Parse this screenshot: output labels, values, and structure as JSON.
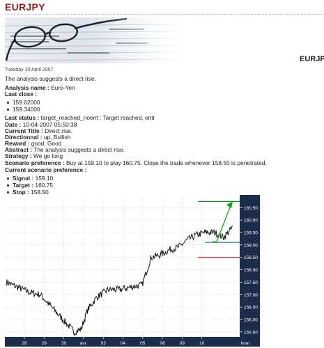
{
  "page": {
    "title": "EURJPY",
    "side_symbol": "EURJPY",
    "date_line": "Tuesday 10 April 2007",
    "summary": "The analysis suggests a direct rise."
  },
  "analysis": {
    "name_label": "Analysis name :",
    "name_value": " Euro-Yen",
    "last_close_label": "Last close :",
    "last_close": [
      "159.62000",
      "159.34000"
    ],
    "status_label": "Last status :",
    "status_value": " target_reached_noent ; Target reached, entr",
    "date_label": "Date :",
    "date_value": " 10-04-2007 05:50:38",
    "title_label": "Current Title :",
    "title_value": " Direct rise.",
    "direction_label": "Directionnal :",
    "direction_value": " up, Bullish",
    "reward_label": "Reward :",
    "reward_value": " good, Good",
    "abstract_label": "Abstract :",
    "abstract_value": " The analysis suggests a direct rise.",
    "strategy_label": "Strategy :",
    "strategy_value": " We go long",
    "scenario_label": "Scenario preference :",
    "scenario_value": " Buy at 159.10 to play 160.75. Close the trade whenever 158.50 is penetrated.",
    "current_pref_label": "Current scenario preference :",
    "signal_label": "Signal :",
    "signal_value": "159.10",
    "target_label": "Target :",
    "target_value": "160.75",
    "stop_label": "Stop :",
    "stop_value": "158.50"
  },
  "chart_data": {
    "type": "line",
    "instrument": "EURJPY",
    "y_ticks": [
      "155.50",
      "156.00",
      "156.50",
      "157.00",
      "157.50",
      "158.00",
      "158.50",
      "159.00",
      "159.50",
      "160.00",
      "160.50"
    ],
    "x_ticks": [
      "28",
      "29",
      "30",
      "avr.",
      "03",
      "04",
      "05",
      "06",
      "09",
      "10",
      "hour"
    ],
    "ylim": [
      155.3,
      160.9
    ],
    "levels": [
      {
        "name": "Target",
        "value": 160.75,
        "label": "160",
        "color": "#0b9a16"
      },
      {
        "name": "Signal",
        "value": 159.1,
        "label": "159.10",
        "color": "#2f8bb0"
      },
      {
        "name": "Stop",
        "value": 158.5,
        "label": "158.50",
        "color": "#c41414"
      }
    ],
    "target_tag_suffix": "Bar",
    "series": [
      {
        "x": [
          0,
          0.5,
          1,
          1.5,
          2,
          2.5,
          3,
          3.3,
          3.6,
          4,
          4.5,
          5,
          5.5,
          6,
          6.4,
          6.8,
          7.2,
          7.6,
          8,
          8.4,
          8.8,
          9.2,
          9.6,
          10
        ],
        "values": [
          157.5,
          157.3,
          157.1,
          157.0,
          156.5,
          156.0,
          155.5,
          155.6,
          156.4,
          156.9,
          157.2,
          157.2,
          157.3,
          157.4,
          158.5,
          158.6,
          158.8,
          158.9,
          159.2,
          159.4,
          159.5,
          159.5,
          159.3,
          159.7
        ]
      }
    ]
  },
  "colors": {
    "title": "#9b1b1b",
    "axis_bg": "#1c2c4b",
    "grid": "#c8c8c8",
    "price": "#111111",
    "arrow": "#12a61c"
  }
}
